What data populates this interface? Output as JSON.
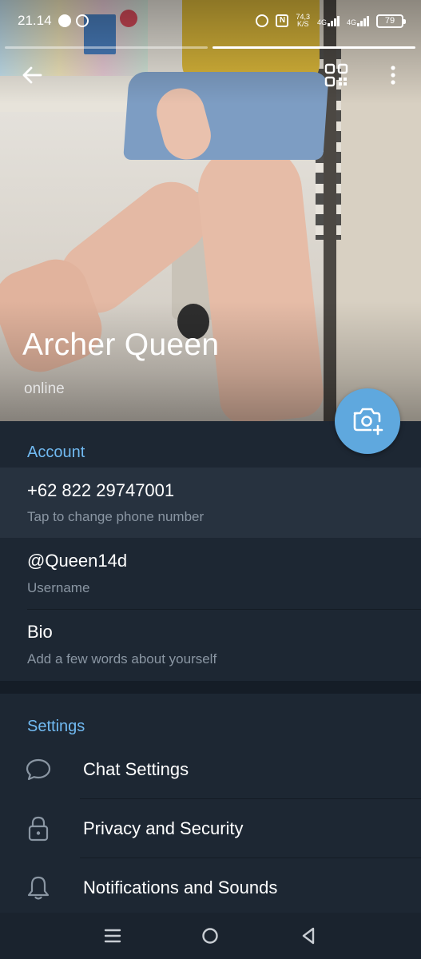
{
  "status_bar": {
    "time": "21.14",
    "speed_top": "74,3",
    "speed_bottom": "K/S",
    "network_1": "4G",
    "network_2": "4G",
    "battery": "79"
  },
  "profile": {
    "name": "Archer Queen",
    "status": "online"
  },
  "account": {
    "title": "Account",
    "phone": "+62 822 29747001",
    "phone_hint": "Tap to change phone number",
    "username": "@Queen14d",
    "username_hint": "Username",
    "bio": "Bio",
    "bio_hint": "Add a few words about yourself"
  },
  "settings": {
    "title": "Settings",
    "items": [
      {
        "label": "Chat Settings",
        "icon": "chat-bubble-icon"
      },
      {
        "label": "Privacy and Security",
        "icon": "lock-icon"
      },
      {
        "label": "Notifications and Sounds",
        "icon": "bell-icon"
      }
    ]
  },
  "colors": {
    "accent": "#71baf2",
    "fab": "#5fa8de",
    "background": "#1d2733",
    "highlight_row": "#27323f"
  }
}
